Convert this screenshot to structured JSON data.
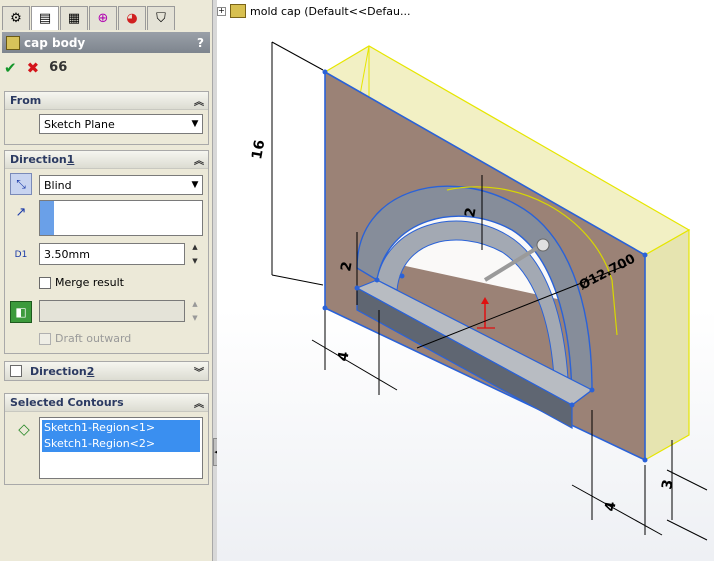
{
  "property_manager": {
    "tabs": [
      "feature-manager-icon",
      "property-manager-icon",
      "configuration-manager-icon",
      "dimxpert-icon",
      "display-manager-icon",
      "filter-icon"
    ],
    "feature_name": "cap body",
    "help_glyph": "?",
    "actions": {
      "ok_glyph": "✔",
      "cancel_glyph": "✖",
      "preview_glyph": "66"
    },
    "from": {
      "label": "From",
      "selected": "Sketch Plane"
    },
    "direction1": {
      "label_prefix": "Direction ",
      "label_number": "1",
      "end_condition": "Blind",
      "depth_value": "3.50mm",
      "depth_symbol": "D1",
      "merge_result_label": "Merge result",
      "merge_result_checked": true,
      "draft_outward_label": "Draft outward"
    },
    "direction2": {
      "label_prefix": "Direction ",
      "label_number": "2"
    },
    "selected_contours": {
      "label": "Selected Contours",
      "items": [
        "Sketch1-Region<1>",
        "Sketch1-Region<2>"
      ]
    }
  },
  "graphics": {
    "tree_item": "mold cap  (Default<<Defau...",
    "dimensions": {
      "height": "16",
      "arch_thickness": "2",
      "left_leg_height": "2",
      "diameter": "Ø12.700",
      "width_left": "4",
      "width_right": "4",
      "depth": "3"
    },
    "colors": {
      "plate_face": "#9b8276",
      "plate_side": "#e8e6b4",
      "edge_highlight": "#e6e600",
      "selected_edge": "#2a62d8",
      "extrusion": "#7d8594"
    }
  }
}
